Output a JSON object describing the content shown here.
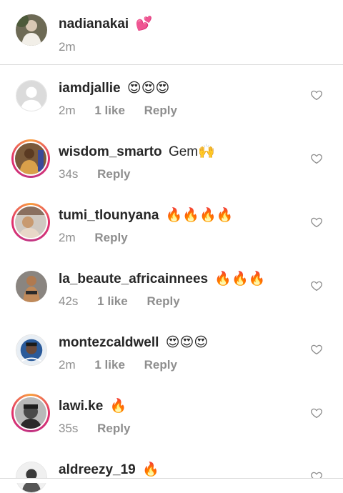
{
  "caption": {
    "username": "nadianakai",
    "text": "💕",
    "time": "2m"
  },
  "comments": [
    {
      "username": "iamdjallie",
      "text": "😍😍😍",
      "time": "2m",
      "likes": "1 like",
      "reply": "Reply"
    },
    {
      "username": "wisdom_smarto",
      "text": "Gem🙌",
      "time": "34s",
      "likes": "",
      "reply": "Reply"
    },
    {
      "username": "tumi_tlounyana",
      "text": "🔥🔥🔥🔥",
      "time": "2m",
      "likes": "",
      "reply": "Reply"
    },
    {
      "username": "la_beaute_africainnees",
      "text": "🔥🔥🔥",
      "time": "42s",
      "likes": "1 like",
      "reply": "Reply"
    },
    {
      "username": "montezcaldwell",
      "text": "😍😍😍",
      "time": "2m",
      "likes": "1 like",
      "reply": "Reply"
    },
    {
      "username": "lawi.ke",
      "text": "🔥",
      "time": "35s",
      "likes": "",
      "reply": "Reply"
    },
    {
      "username": "aldreezy_19",
      "text": "🔥",
      "time": "",
      "likes": "",
      "reply": ""
    }
  ],
  "icons": {
    "like": "heart-outline-icon"
  },
  "colors": {
    "text": "#262626",
    "secondary": "#8e8e8e",
    "divider": "#dbdbdb"
  }
}
